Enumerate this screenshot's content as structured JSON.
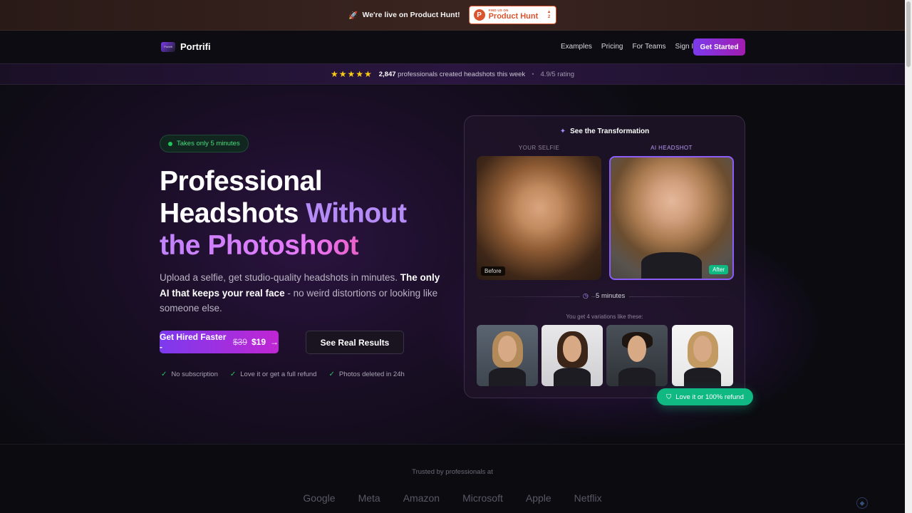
{
  "banner": {
    "rocket_icon": "rocket-icon",
    "message": "We're live on Product Hunt!",
    "ph_small": "FIND US ON",
    "ph_big": "Product Hunt",
    "ph_letter": "P",
    "ph_arrow": "▲",
    "ph_count": "2"
  },
  "nav": {
    "brand_logo_text": "Portrifi",
    "brand": "Portrifi",
    "links": [
      "Examples",
      "Pricing",
      "For Teams",
      "Sign In"
    ],
    "cta": "Get Started"
  },
  "rating": {
    "stars": "★★★★★",
    "count": "2,847",
    "desc": "professionals created headshots this week",
    "separator": "•",
    "score": "4.9/5 rating"
  },
  "hero": {
    "pill": "Takes only 5 minutes",
    "headline_line1": "Professional",
    "headline_line2a": "Headshots",
    "headline_line2b": "Without",
    "headline_line3": "the Photoshoot",
    "sub_a": "Upload a selfie, get studio-quality headshots in minutes.",
    "sub_b": "The only AI that keeps your real face",
    "sub_c": "- no weird distortions or looking like someone else.",
    "cta_primary_label": "Get Hired Faster -",
    "cta_old_price": "$39",
    "cta_new_price": "$19",
    "cta_arrow": "→",
    "cta_secondary": "See Real Results",
    "checks": [
      "No subscription",
      "Love it or get a full refund",
      "Photos deleted in 24h"
    ],
    "check_mark": "✓"
  },
  "card": {
    "title": "See the Transformation",
    "spark": "✦",
    "label_before": "YOUR SELFIE",
    "label_after": "AI HEADSHOT",
    "tag_before": "Before",
    "tag_after": "After",
    "clock": "◷",
    "time": "5 minutes",
    "variations": "You get 4 variations like these:",
    "refund_icon": "⛉",
    "refund": "Love it or 100% refund"
  },
  "trusted": {
    "label": "Trusted by professionals at",
    "logos": [
      "Google",
      "Meta",
      "Amazon",
      "Microsoft",
      "Apple",
      "Netflix"
    ]
  },
  "colors": {
    "accent": "#7c3aed",
    "accent_pink": "#c026d3",
    "success": "#10b981",
    "star": "#facc15",
    "product_hunt": "#da552f"
  }
}
